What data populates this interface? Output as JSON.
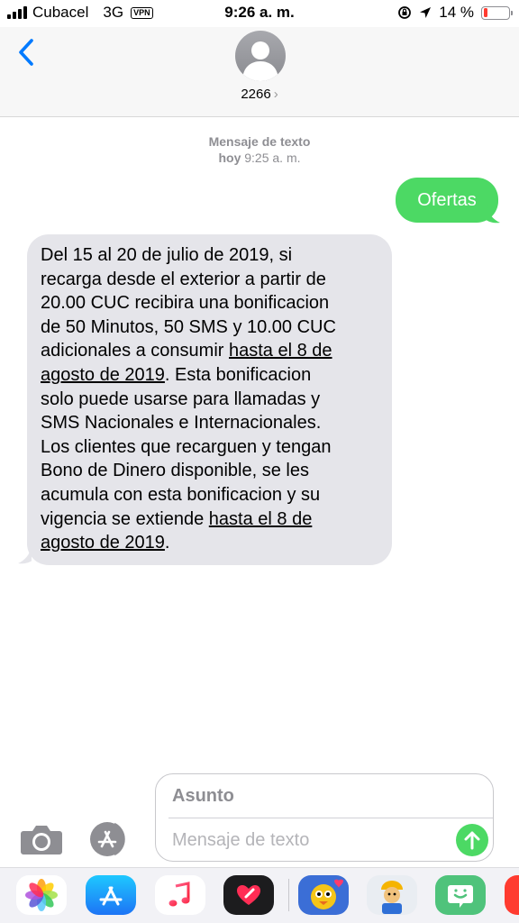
{
  "status_bar": {
    "carrier": "Cubacel",
    "network": "3G",
    "vpn": "VPN",
    "time": "9:26 a. m.",
    "battery_percent": "14 %",
    "battery_level": 0.14
  },
  "header": {
    "contact": "2266"
  },
  "conversation": {
    "service_label": "Mensaje de texto",
    "day": "hoy",
    "time": "9:25 a. m.",
    "sent_message": "Ofertas",
    "received_lines": [
      {
        "a": "Del 15 al 20 de julio de 2019, si",
        "link": "",
        "b": ""
      },
      {
        "a": "recarga desde el exterior a partir de",
        "link": "",
        "b": ""
      },
      {
        "a": "20.00 CUC recibira una bonificacion",
        "link": "",
        "b": ""
      },
      {
        "a": "de 50 Minutos, 50 SMS y 10.00 CUC",
        "link": "",
        "b": ""
      },
      {
        "a": "adicionales a consumir ",
        "link": "hasta el 8 de",
        "b": ""
      },
      {
        "a": "",
        "link": "agosto de 2019",
        "b": ". Esta bonificacion"
      },
      {
        "a": "solo puede usarse para llamadas y",
        "link": "",
        "b": ""
      },
      {
        "a": "SMS Nacionales e Internacionales.",
        "link": "",
        "b": ""
      },
      {
        "a": "Los clientes que recarguen y tengan",
        "link": "",
        "b": ""
      },
      {
        "a": "Bono de Dinero disponible, se les",
        "link": "",
        "b": ""
      },
      {
        "a": "acumula con esta bonificacion y su",
        "link": "",
        "b": ""
      },
      {
        "a": "vigencia se extiende ",
        "link": "hasta el 8 de",
        "b": ""
      },
      {
        "a": "",
        "link": "agosto de 2019",
        "b": "."
      }
    ]
  },
  "composer": {
    "subject_placeholder": "Asunto",
    "message_placeholder": "Mensaje de texto"
  },
  "apps": [
    {
      "name": "Photos",
      "icon": "photos-icon"
    },
    {
      "name": "App Store",
      "icon": "app-store-icon"
    },
    {
      "name": "Music",
      "icon": "music-icon"
    },
    {
      "name": "Digital Touch",
      "icon": "digital-touch-icon"
    },
    {
      "name": "Sticker",
      "icon": "bird-sticker-icon"
    },
    {
      "name": "Sticker",
      "icon": "worker-sticker-icon"
    },
    {
      "name": "Bitmoji",
      "icon": "bitmoji-icon"
    }
  ],
  "colors": {
    "accent_blue": "#007aff",
    "sms_green": "#4cd964",
    "incoming_gray": "#e5e5ea"
  }
}
